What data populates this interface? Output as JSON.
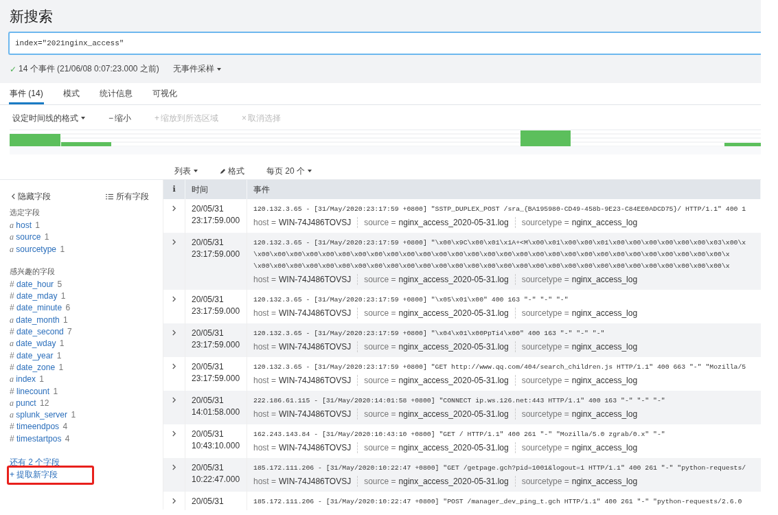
{
  "title": "新搜索",
  "search": {
    "value": "index=\"2021nginx_access\""
  },
  "status": {
    "check": "✓",
    "text": "14 个事件 (21/06/08 0:07:23.000 之前)",
    "sampling": "无事件采样"
  },
  "tabs": [
    {
      "label": "事件 (14)",
      "selected": true
    },
    {
      "label": "模式",
      "selected": false
    },
    {
      "label": "统计信息",
      "selected": false
    },
    {
      "label": "可视化",
      "selected": false
    }
  ],
  "timeline_toolbar": [
    {
      "label": "设定时间线的格式",
      "caret": true,
      "disabled": false
    },
    {
      "glyph": "−",
      "label": "缩小",
      "caret": false,
      "disabled": false
    },
    {
      "glyph": "+",
      "label": "缩放到所选区域",
      "caret": false,
      "disabled": true
    },
    {
      "glyph": "×",
      "label": "取消选择",
      "caret": false,
      "disabled": true
    }
  ],
  "list_controls": [
    {
      "kind": "dropdown",
      "label": "列表"
    },
    {
      "kind": "format",
      "label": "格式"
    },
    {
      "kind": "dropdown",
      "label": "每页 20 个"
    }
  ],
  "sidebar": {
    "hide": "隐藏字段",
    "all": "所有字段",
    "sections": [
      {
        "title": "选定字段",
        "fields": [
          {
            "glyph": "a",
            "name": "host",
            "count": "1"
          },
          {
            "glyph": "a",
            "name": "source",
            "count": "1"
          },
          {
            "glyph": "a",
            "name": "sourcetype",
            "count": "1"
          }
        ]
      },
      {
        "title": "感兴趣的字段",
        "fields": [
          {
            "glyph": "#",
            "name": "date_hour",
            "count": "5"
          },
          {
            "glyph": "#",
            "name": "date_mday",
            "count": "1"
          },
          {
            "glyph": "#",
            "name": "date_minute",
            "count": "6"
          },
          {
            "glyph": "a",
            "name": "date_month",
            "count": "1"
          },
          {
            "glyph": "#",
            "name": "date_second",
            "count": "7"
          },
          {
            "glyph": "a",
            "name": "date_wday",
            "count": "1"
          },
          {
            "glyph": "#",
            "name": "date_year",
            "count": "1"
          },
          {
            "glyph": "#",
            "name": "date_zone",
            "count": "1"
          },
          {
            "glyph": "a",
            "name": "index",
            "count": "1"
          },
          {
            "glyph": "#",
            "name": "linecount",
            "count": "1"
          },
          {
            "glyph": "a",
            "name": "punct",
            "count": "12"
          },
          {
            "glyph": "a",
            "name": "splunk_server",
            "count": "1"
          },
          {
            "glyph": "#",
            "name": "timeendpos",
            "count": "4"
          },
          {
            "glyph": "#",
            "name": "timestartpos",
            "count": "4"
          }
        ]
      }
    ],
    "more": "还有 2 个字段",
    "extract": "+ 提取新字段"
  },
  "table": {
    "columns": [
      "i",
      "时间",
      "事件"
    ],
    "rows": [
      {
        "date": "20/05/31",
        "time": "23:17:59.000",
        "lines": [
          "120.132.3.65 - [31/May/2020:23:17:59 +0800] \"SSTP_DUPLEX_POST /sra_{BA195980-CD49-458b-9E23-C84EE0ADCD75}/ HTTP/1.1\" 400 1"
        ],
        "fields": [
          {
            "key": "host =",
            "value": "WIN-74J486TOVSJ"
          },
          {
            "key": "source =",
            "value": "nginx_access_2020-05-31.log"
          },
          {
            "key": "sourcetype =",
            "value": "nginx_access_log"
          }
        ]
      },
      {
        "date": "20/05/31",
        "time": "23:17:59.000",
        "lines": [
          "120.132.3.65 - [31/May/2020:23:17:59 +0800] \"\\x00\\x9C\\x00\\x01\\x1A+<M\\x00\\x01\\x00\\x00\\x01\\x00\\x00\\x00\\x00\\x00\\x00\\x03\\x00\\x",
          "\\x00\\x00\\x00\\x00\\x00\\x00\\x00\\x00\\x00\\x00\\x00\\x00\\x00\\x00\\x00\\x00\\x00\\x00\\x00\\x00\\x00\\x00\\x00\\x00\\x00\\x00\\x00\\x00\\x00\\x",
          "\\x00\\x00\\x00\\x00\\x00\\x00\\x00\\x00\\x00\\x00\\x00\\x00\\x00\\x00\\x00\\x00\\x00\\x00\\x00\\x00\\x00\\x00\\x00\\x00\\x00\\x00\\x00\\x00\\x00\\x"
        ],
        "fields": [
          {
            "key": "host =",
            "value": "WIN-74J486TOVSJ"
          },
          {
            "key": "source =",
            "value": "nginx_access_2020-05-31.log"
          },
          {
            "key": "sourcetype =",
            "value": "nginx_access_log"
          }
        ]
      },
      {
        "date": "20/05/31",
        "time": "23:17:59.000",
        "lines": [
          "120.132.3.65 - [31/May/2020:23:17:59 +0800] \"\\x05\\x01\\x00\" 400 163 \"-\" \"-\" \"-\""
        ],
        "fields": [
          {
            "key": "host =",
            "value": "WIN-74J486TOVSJ"
          },
          {
            "key": "source =",
            "value": "nginx_access_2020-05-31.log"
          },
          {
            "key": "sourcetype =",
            "value": "nginx_access_log"
          }
        ]
      },
      {
        "date": "20/05/31",
        "time": "23:17:59.000",
        "lines": [
          "120.132.3.65 - [31/May/2020:23:17:59 +0800] \"\\x04\\x01\\x00PpTi4\\x00\" 400 163 \"-\" \"-\" \"-\""
        ],
        "fields": [
          {
            "key": "host =",
            "value": "WIN-74J486TOVSJ"
          },
          {
            "key": "source =",
            "value": "nginx_access_2020-05-31.log"
          },
          {
            "key": "sourcetype =",
            "value": "nginx_access_log"
          }
        ]
      },
      {
        "date": "20/05/31",
        "time": "23:17:59.000",
        "lines": [
          "120.132.3.65 - [31/May/2020:23:17:59 +0800] \"GET http://www.qq.com/404/search_children.js HTTP/1.1\" 400 663 \"-\" \"Mozilla/5"
        ],
        "fields": [
          {
            "key": "host =",
            "value": "WIN-74J486TOVSJ"
          },
          {
            "key": "source =",
            "value": "nginx_access_2020-05-31.log"
          },
          {
            "key": "sourcetype =",
            "value": "nginx_access_log"
          }
        ]
      },
      {
        "date": "20/05/31",
        "time": "14:01:58.000",
        "lines": [
          "222.186.61.115 - [31/May/2020:14:01:58 +0800] \"CONNECT ip.ws.126.net:443 HTTP/1.1\" 400 163 \"-\" \"-\" \"-\""
        ],
        "fields": [
          {
            "key": "host =",
            "value": "WIN-74J486TOVSJ"
          },
          {
            "key": "source =",
            "value": "nginx_access_2020-05-31.log"
          },
          {
            "key": "sourcetype =",
            "value": "nginx_access_log"
          }
        ]
      },
      {
        "date": "20/05/31",
        "time": "10:43:10.000",
        "lines": [
          "162.243.143.84 - [31/May/2020:10:43:10 +0800] \"GET / HTTP/1.1\" 400 261 \"-\" \"Mozilla/5.0 zgrab/0.x\" \"-\""
        ],
        "fields": [
          {
            "key": "host =",
            "value": "WIN-74J486TOVSJ"
          },
          {
            "key": "source =",
            "value": "nginx_access_2020-05-31.log"
          },
          {
            "key": "sourcetype =",
            "value": "nginx_access_log"
          }
        ]
      },
      {
        "date": "20/05/31",
        "time": "10:22:47.000",
        "lines": [
          "185.172.111.206 - [31/May/2020:10:22:47 +0800] \"GET /getpage.gch?pid=1001&logout=1 HTTP/1.1\" 400 261 \"-\" \"python-requests/"
        ],
        "fields": [
          {
            "key": "host =",
            "value": "WIN-74J486TOVSJ"
          },
          {
            "key": "source =",
            "value": "nginx_access_2020-05-31.log"
          },
          {
            "key": "sourcetype =",
            "value": "nginx_access_log"
          }
        ]
      },
      {
        "date": "20/05/31",
        "lines": [
          "185.172.111.206 - [31/May/2020:10:22:47 +0800] \"POST /manager_dev_ping_t.gch HTTP/1.1\" 400 261 \"-\" \"python-requests/2.6.0"
        ]
      }
    ]
  }
}
